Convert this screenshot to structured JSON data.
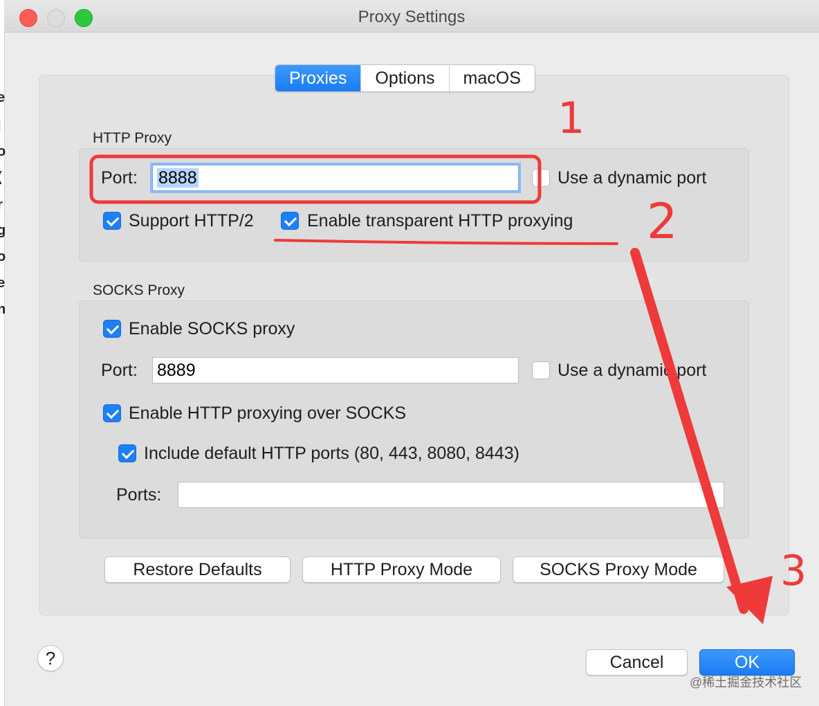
{
  "window": {
    "title": "Proxy Settings"
  },
  "tabs": [
    {
      "label": "Proxies",
      "active": true
    },
    {
      "label": "Options",
      "active": false
    },
    {
      "label": "macOS",
      "active": false
    }
  ],
  "http_proxy": {
    "section_label": "HTTP Proxy",
    "port_label": "Port:",
    "port_value": "8888",
    "dynamic_port_label": "Use a dynamic port",
    "dynamic_port_checked": false,
    "support_http2_label": "Support HTTP/2",
    "support_http2_checked": true,
    "transparent_label": "Enable transparent HTTP proxying",
    "transparent_checked": true
  },
  "socks_proxy": {
    "section_label": "SOCKS Proxy",
    "enable_label": "Enable SOCKS proxy",
    "enable_checked": true,
    "port_label": "Port:",
    "port_value": "8889",
    "dynamic_port_label": "Use a dynamic port",
    "dynamic_port_checked": false,
    "http_over_socks_label": "Enable HTTP proxying over SOCKS",
    "http_over_socks_checked": true,
    "default_ports_label": "Include default HTTP ports (80, 443, 8080, 8443)",
    "default_ports_checked": true,
    "ports_label": "Ports:",
    "ports_value": ""
  },
  "buttons": {
    "restore_defaults": "Restore Defaults",
    "http_proxy_mode": "HTTP Proxy Mode",
    "socks_proxy_mode": "SOCKS Proxy Mode",
    "cancel": "Cancel",
    "ok": "OK",
    "help": "?"
  },
  "annotations": {
    "marker_1": "1",
    "marker_2": "2",
    "marker_3": "3",
    "color": "#ee3a3a"
  },
  "watermark": "@稀土掘金技术社区",
  "colors": {
    "accent": "#1e80f6",
    "annotation": "#ee3a3a"
  }
}
